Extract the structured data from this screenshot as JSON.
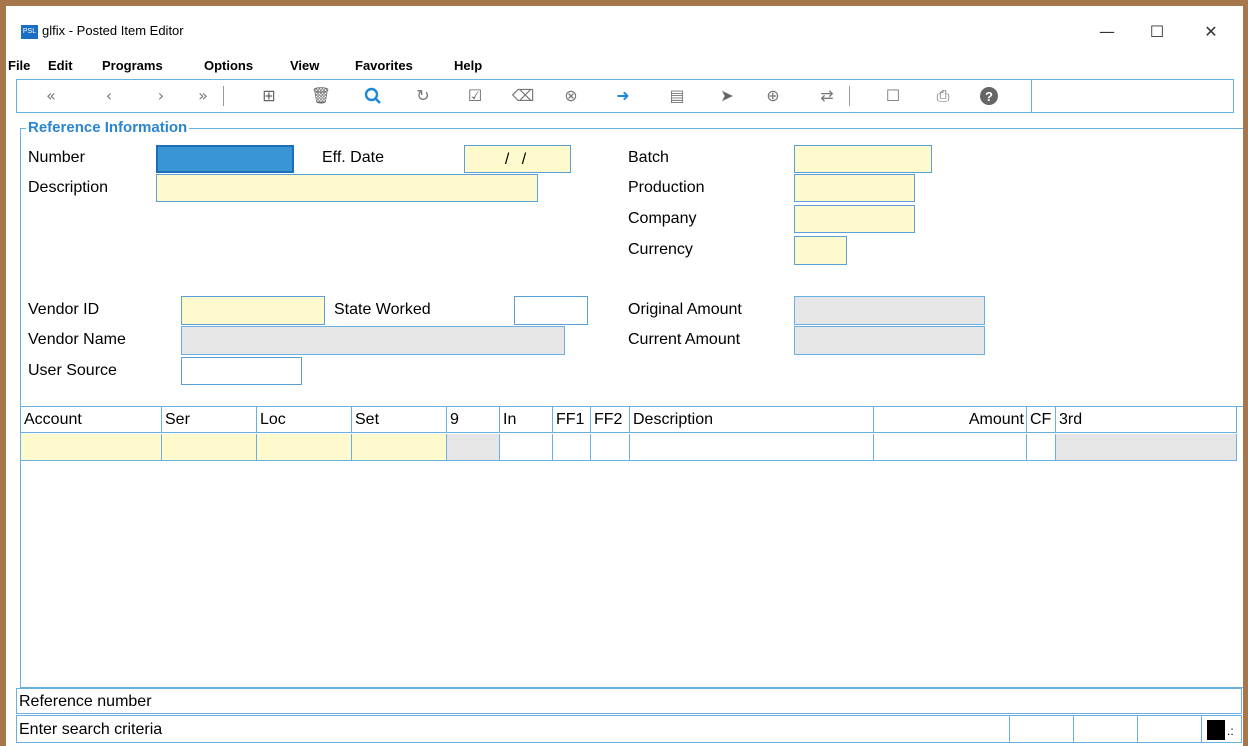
{
  "window": {
    "title": "glfix - Posted Item Editor",
    "app_icon_text": "PSL",
    "controls": {
      "minimize": "—",
      "maximize": "☐",
      "close": "✕"
    }
  },
  "menu": [
    "File",
    "Edit",
    "Programs",
    "Options",
    "View",
    "Favorites",
    "Help"
  ],
  "toolbar": {
    "icons": [
      "first-icon",
      "prev-icon",
      "next-icon",
      "last-icon",
      "add-icon",
      "delete-icon",
      "search-icon",
      "refresh-icon",
      "check-icon",
      "erase-icon",
      "cancel-icon",
      "exit-icon",
      "list-icon",
      "pointer-icon",
      "zoom-icon",
      "swap-icon",
      "note-icon",
      "print-icon",
      "help-icon"
    ]
  },
  "reference": {
    "group_title": "Reference Information",
    "number_label": "Number",
    "number_value": "",
    "effdate_label": "Eff. Date",
    "effdate_value": "/  /",
    "batch_label": "Batch",
    "description_label": "Description",
    "production_label": "Production",
    "company_label": "Company",
    "currency_label": "Currency",
    "vendor_id_label": "Vendor ID",
    "state_worked_label": "State Worked",
    "original_amount_label": "Original Amount",
    "vendor_name_label": "Vendor Name",
    "current_amount_label": "Current Amount",
    "user_source_label": "User Source"
  },
  "grid": {
    "columns": [
      "Account",
      "Ser",
      "Loc",
      "Set",
      "9",
      "In",
      "FF1",
      "FF2",
      "Description",
      "Amount",
      "CF",
      "3rd"
    ]
  },
  "status": {
    "hint": "Reference number",
    "message": "Enter search criteria"
  }
}
